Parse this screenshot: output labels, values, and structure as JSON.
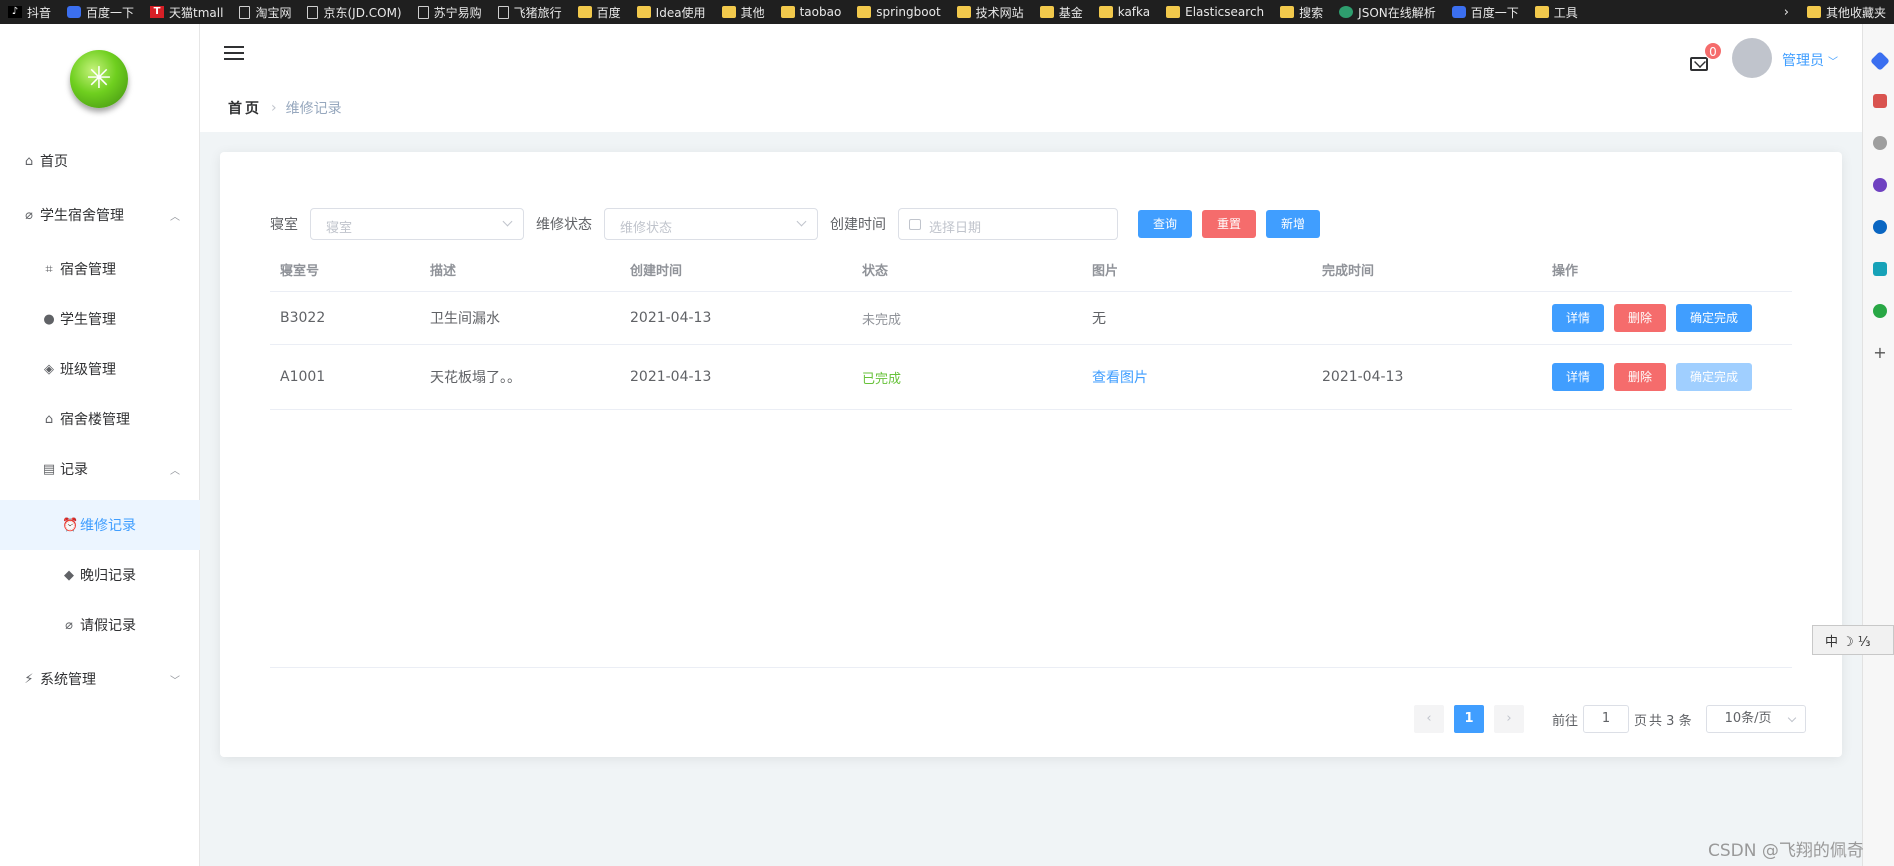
{
  "bookmarks": [
    {
      "label": "抖音",
      "icon": "tiktok-icon"
    },
    {
      "label": "百度一下",
      "icon": "baidu-icon"
    },
    {
      "label": "天猫tmall",
      "icon": "tmall-icon"
    },
    {
      "label": "淘宝网",
      "icon": "page-icon"
    },
    {
      "label": "京东(JD.COM)",
      "icon": "page-icon"
    },
    {
      "label": "苏宁易购",
      "icon": "page-icon"
    },
    {
      "label": "飞猪旅行",
      "icon": "page-icon"
    },
    {
      "label": "百度",
      "icon": "folder-icon"
    },
    {
      "label": "Idea使用",
      "icon": "folder-icon"
    },
    {
      "label": "其他",
      "icon": "folder-icon"
    },
    {
      "label": "taobao",
      "icon": "folder-icon"
    },
    {
      "label": "springboot",
      "icon": "folder-icon"
    },
    {
      "label": "技术网站",
      "icon": "folder-icon"
    },
    {
      "label": "基金",
      "icon": "folder-icon"
    },
    {
      "label": "kafka",
      "icon": "folder-icon"
    },
    {
      "label": "Elasticsearch",
      "icon": "folder-icon"
    },
    {
      "label": "搜索",
      "icon": "folder-icon"
    },
    {
      "label": "JSON在线解析",
      "icon": "json-icon"
    },
    {
      "label": "百度一下",
      "icon": "baidu-icon"
    },
    {
      "label": "工具",
      "icon": "folder-icon"
    }
  ],
  "bookmarks_more": "›",
  "bookmarks_other": "其他收藏夹",
  "sidebar": {
    "home": "首页",
    "dorm_mgmt": "学生宿舍管理",
    "dorm": "宿舍管理",
    "student": "学生管理",
    "class": "班级管理",
    "building": "宿舍楼管理",
    "records": "记录",
    "repair": "维修记录",
    "late": "晚归记录",
    "leave": "请假记录",
    "system": "系统管理"
  },
  "header": {
    "breadcrumb_home": "首页",
    "breadcrumb_current": "维修记录",
    "mail_count": "0",
    "user": "管理员"
  },
  "filter": {
    "room_label": "寝室",
    "room_placeholder": "寝室",
    "status_label": "维修状态",
    "status_placeholder": "维修状态",
    "date_label": "创建时间",
    "date_placeholder": "选择日期",
    "query": "查询",
    "reset": "重置",
    "add": "新增"
  },
  "table": {
    "columns": [
      "寝室号",
      "描述",
      "创建时间",
      "状态",
      "图片",
      "完成时间",
      "操作"
    ],
    "rows": [
      {
        "room": "B3022",
        "desc": "卫生间漏水",
        "created": "2021-04-13",
        "status": "未完成",
        "image": "无",
        "finished": ""
      },
      {
        "room": "A1001",
        "desc": "天花板塌了。。",
        "created": "2021-04-13",
        "status": "已完成",
        "image": "查看图片",
        "finished": "2021-04-13"
      }
    ],
    "actions": {
      "detail": "详情",
      "delete": "删除",
      "confirm": "确定完成"
    }
  },
  "pagination": {
    "prev": "‹",
    "current": "1",
    "next": "›",
    "goto_prefix": "前往",
    "goto_value": "1",
    "goto_suffix": "页",
    "total": "共 3 条",
    "page_size": "10条/页"
  },
  "ime": "中 ☽ ⅓",
  "watermark": "CSDN @飞翔的佩奇",
  "colors": {
    "primary": "#409eff",
    "danger": "#f56c6c",
    "success": "#67c23a",
    "disabled": "#a0cfff"
  }
}
